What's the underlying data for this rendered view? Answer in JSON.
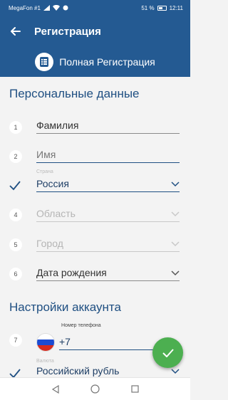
{
  "status_bar": {
    "carrier": "MegaFon #1",
    "battery": "51 %",
    "time": "12:11"
  },
  "app_bar": {
    "title": "Регистрация",
    "subtitle": "Полная Регистрация"
  },
  "personal": {
    "heading": "Персональные данные",
    "fields": [
      {
        "num": "1",
        "value": "Фамилия"
      },
      {
        "num": "2",
        "value": "Имя"
      },
      {
        "small_label": "Страна",
        "value": "Россия"
      },
      {
        "num": "4",
        "value": "Область"
      },
      {
        "num": "5",
        "value": "Город"
      },
      {
        "num": "6",
        "value": "Дата рождения"
      }
    ]
  },
  "account": {
    "heading": "Настройки аккаунта",
    "phone": {
      "num": "7",
      "label": "Номер телефона",
      "value": "+7"
    },
    "currency": {
      "small_label": "Валюта",
      "value": "Российский рубль"
    }
  },
  "colors": {
    "primary": "#245a92",
    "accent": "#4caf50",
    "heading": "#1f4f82"
  }
}
